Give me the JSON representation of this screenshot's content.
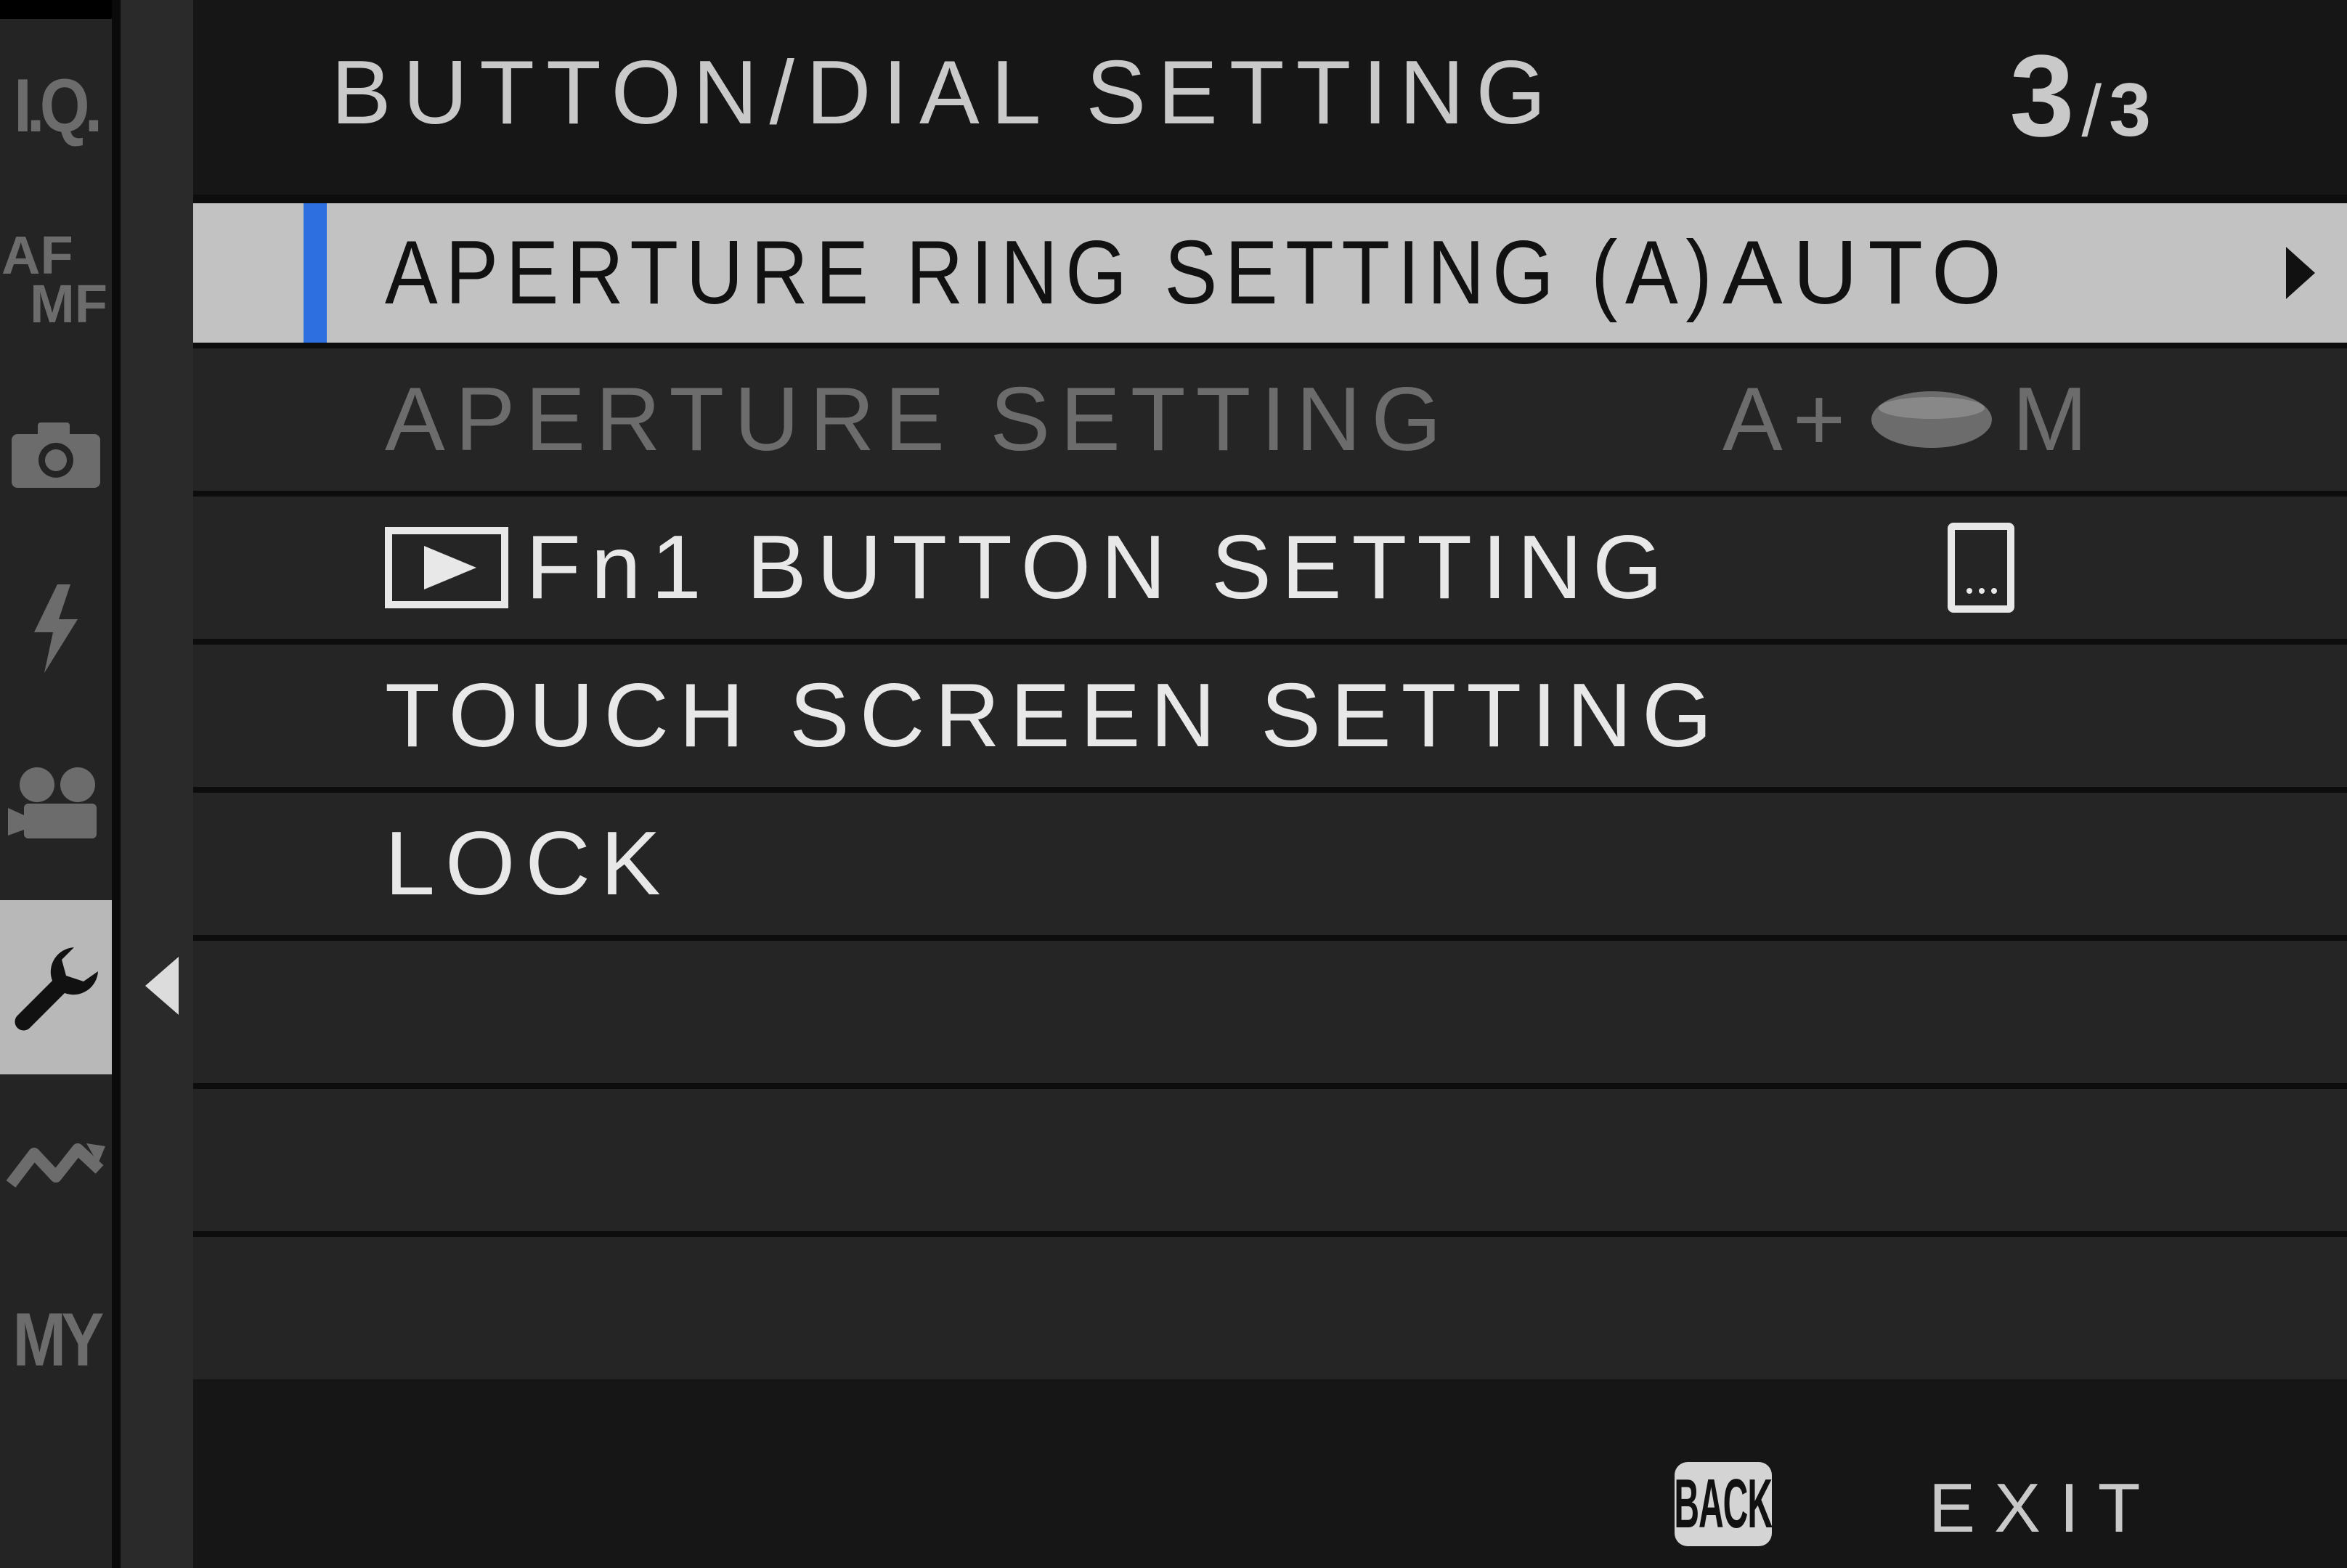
{
  "header": {
    "title": "BUTTON/DIAL SETTING",
    "page_current": "3",
    "page_separator": "/",
    "page_total": "3"
  },
  "sidebar": {
    "items": [
      {
        "label": "I.Q.",
        "icon": "image-quality-icon"
      },
      {
        "label_line1": "AF",
        "label_line2": "MF",
        "icon": "af-mf-icon"
      },
      {
        "icon": "camera-icon"
      },
      {
        "icon": "flash-icon"
      },
      {
        "icon": "movie-icon"
      },
      {
        "icon": "wrench-icon",
        "active": true
      },
      {
        "icon": "connection-icon"
      },
      {
        "label": "MY",
        "icon": "my-menu-icon"
      }
    ]
  },
  "menu": {
    "items": [
      {
        "label": "APERTURE RING SETTING (A)",
        "value": "AUTO",
        "selected": true,
        "disabled": false
      },
      {
        "label": "APERTURE SETTING",
        "value_prefix": "A+",
        "value_icon": "aperture-ring-icon",
        "value_suffix": "M",
        "selected": false,
        "disabled": true
      },
      {
        "label": "Fn1 BUTTON SETTING",
        "label_icon": "playback-icon",
        "value_icon": "smartphone-icon",
        "selected": false,
        "disabled": false
      },
      {
        "label": "TOUCH SCREEN SETTING",
        "selected": false,
        "disabled": false
      },
      {
        "label": "LOCK",
        "selected": false,
        "disabled": false
      }
    ]
  },
  "footer": {
    "back_label": "BACK",
    "exit_label": "EXIT"
  },
  "colors": {
    "selection_accent": "#2d6fe0",
    "selected_row": "#c2c2c2",
    "row_background": "#252525",
    "text_primary": "#e8e8e8",
    "text_disabled": "#6c6c6c"
  }
}
